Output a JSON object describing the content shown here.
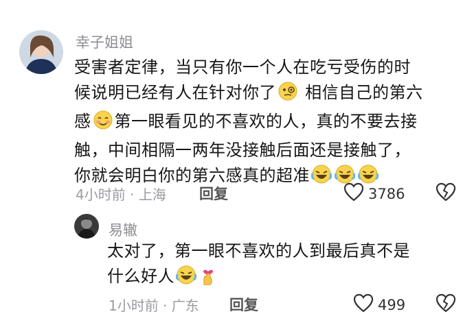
{
  "header": {
    "partial_text": ""
  },
  "comments": [
    {
      "author": "幸子姐姐",
      "lines": [
        "受害者定律，当只有你一个人在吃亏受伤的时",
        "候说明已经有人在针对你了",
        " 相信自己的第六",
        "感",
        "第一眼看见的不喜欢的人，真的不要去接",
        "触，中间相隔一两年没接触后面还是接触了，",
        "你就会明白你的第六感真的超准"
      ],
      "time": "4小时前",
      "location": "上海",
      "reply_label": "回复",
      "likes": "3786"
    },
    {
      "author": "易辙",
      "lines": [
        "太对了，第一眼不喜欢的人到最后真不是",
        "什么好人"
      ],
      "time": "1小时前",
      "location": "广东",
      "reply_label": "回复",
      "likes": "499"
    }
  ],
  "colors": {
    "text": "#161616",
    "meta": "#9a9aa0",
    "name": "#8d8d93"
  },
  "icons": [
    "heart-icon",
    "broken-heart-icon",
    "face-with-monocle-emoji",
    "smiling-blush-emoji",
    "rolling-laughing-emoji",
    "hand-heart-emoji"
  ]
}
